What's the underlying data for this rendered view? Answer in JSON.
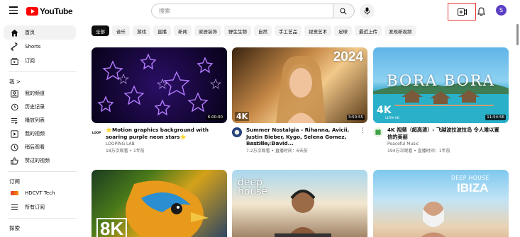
{
  "header": {
    "logo_text": "YouTube",
    "search_placeholder": "搜索",
    "avatar_letter": "S"
  },
  "sidebar": {
    "items": [
      {
        "label": "首页",
        "icon": "home-icon"
      },
      {
        "label": "Shorts",
        "icon": "shorts-icon"
      },
      {
        "label": "订阅",
        "icon": "subscriptions-icon"
      }
    ],
    "you_section": "我 >",
    "you_items": [
      {
        "label": "我的频道",
        "icon": "channel-icon"
      },
      {
        "label": "历史记录",
        "icon": "history-icon"
      },
      {
        "label": "播放列表",
        "icon": "playlist-icon"
      },
      {
        "label": "我的视频",
        "icon": "my-videos-icon"
      },
      {
        "label": "稍后观看",
        "icon": "watch-later-icon"
      },
      {
        "label": "赞过的视频",
        "icon": "liked-icon"
      }
    ],
    "subs_section": "订阅",
    "subs_items": [
      {
        "label": "HDCVT Tech"
      },
      {
        "label": "所有订阅"
      }
    ],
    "explore_section": "探索"
  },
  "chips": [
    "全部",
    "音乐",
    "游戏",
    "直播",
    "新闻",
    "家居装饰",
    "野生生物",
    "自然",
    "手工艺品",
    "视觉艺术",
    "足球",
    "最近上传",
    "发现新视频"
  ],
  "videos": [
    {
      "title": "⭐Motion graphics background with soaring purple neon stars⭐",
      "channel": "LOOPING LAB",
      "stats": "18万次观看 • 1年前",
      "duration": "6:00:00",
      "avatar_text": "LOOP"
    },
    {
      "title": "Summer Nostalgia - Rihanna, Avicii, Justin Bieber, Kygo, Selena Gomez, Bastille, David...",
      "channel": "Deep Atlantic",
      "stats": "7.2万次观看 • 直播时间：6天前",
      "duration": "3:50:55",
      "overlay_text": "2024",
      "badge": "4K"
    },
    {
      "title": "4K 视频（超高清）- 飞越波拉波拉岛 令人难以置信的美丽",
      "channel": "Peaceful Music",
      "stats": "194万次观看 • 直播时间：1年前",
      "duration": "11:54:56",
      "overlay_text": "BORA BORA",
      "badge": "4K",
      "badge_sub": "ULTRA HD"
    },
    {
      "badge": "8K"
    },
    {
      "overlay_text": "deep house"
    },
    {
      "overlay_text_top": "DEEP HOUSE",
      "overlay_text": "IBIZA"
    }
  ]
}
